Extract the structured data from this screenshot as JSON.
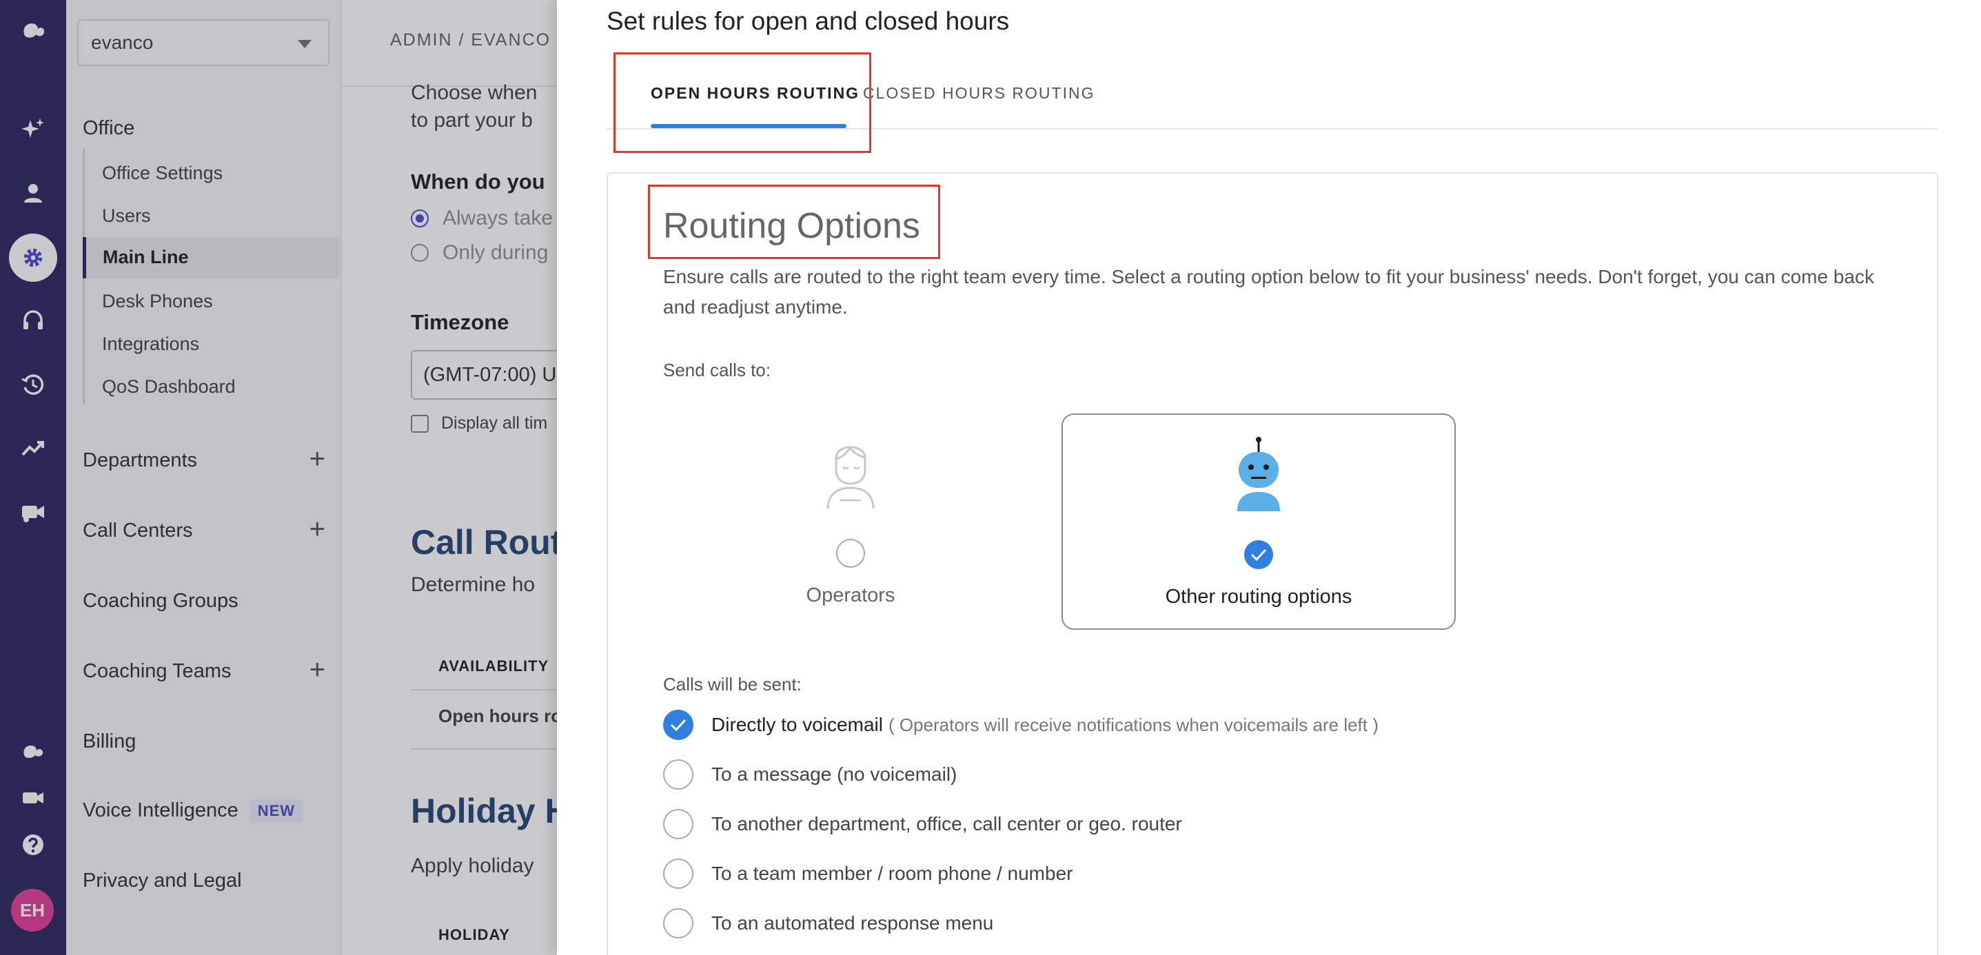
{
  "rail": {
    "icons": [
      "dialpad-logo-icon",
      "ai-sparkle-icon",
      "contacts-person-icon",
      "settings-gear-icon",
      "headset-icon",
      "history-icon",
      "analytics-trend-icon",
      "video-camera-icon",
      "dialpad-small-logo-icon",
      "meetings-video-icon",
      "help-icon"
    ],
    "avatar_initials": "EH",
    "avatar_color": "#e32f8c",
    "background_color": "#1b1656"
  },
  "nav": {
    "org_select_value": "evanco",
    "office_heading": "Office",
    "office_items": [
      "Office Settings",
      "Users",
      "Main Line",
      "Desk Phones",
      "Integrations",
      "QoS Dashboard"
    ],
    "active_item": "Main Line",
    "sections": [
      {
        "label": "Departments",
        "has_add": true
      },
      {
        "label": "Call Centers",
        "has_add": true
      },
      {
        "label": "Coaching Groups",
        "has_add": false
      },
      {
        "label": "Coaching Teams",
        "has_add": true
      },
      {
        "label": "Billing",
        "has_add": false
      },
      {
        "label": "Voice Intelligence",
        "has_add": false,
        "badge": "NEW"
      },
      {
        "label": "Privacy and Legal",
        "has_add": false
      }
    ]
  },
  "main": {
    "breadcrumb": "ADMIN / EVANCO",
    "intro_line1": "Choose when",
    "intro_line2": "to part your b",
    "when_heading": "When do you",
    "radio_always": "Always take",
    "radio_only": "Only during",
    "timezone_heading": "Timezone",
    "timezone_value": "(GMT-07:00) U",
    "display_all_label": "Display all tim",
    "call_routing_heading": "Call Rout",
    "call_routing_sub": "Determine ho",
    "availability_header": "AVAILABILITY",
    "open_hours_row": "Open hours ro",
    "holiday_heading": "Holiday H",
    "holiday_sub": "Apply holiday",
    "holiday_header": "HOLIDAY"
  },
  "drawer": {
    "title": "Set rules for open and closed hours",
    "tabs": [
      {
        "label": "OPEN HOURS ROUTING",
        "active": true
      },
      {
        "label": "CLOSED HOURS ROUTING",
        "active": false
      }
    ],
    "routing_heading": "Routing Options",
    "routing_description": "Ensure calls are routed to the right team every time. Select a routing option below to fit your business' needs. Don't forget, you can come back and readjust anytime.",
    "send_calls_label": "Send calls to:",
    "send_options": [
      {
        "label": "Operators",
        "selected": false,
        "icon": "operator-person-icon"
      },
      {
        "label": "Other routing options",
        "selected": true,
        "icon": "robot-icon"
      }
    ],
    "calls_sent_label": "Calls will be sent:",
    "route_options": [
      {
        "label": "Directly to voicemail",
        "note": "( Operators will receive notifications when voicemails are left )",
        "selected": true
      },
      {
        "label": "To a message (no voicemail)",
        "note": "",
        "selected": false
      },
      {
        "label": "To another department, office, call center or geo. router",
        "note": "",
        "selected": false
      },
      {
        "label": "To a team member / room phone / number",
        "note": "",
        "selected": false
      },
      {
        "label": "To an automated response menu",
        "note": "",
        "selected": false
      }
    ],
    "accent_color": "#2f7fe0",
    "highlight_color": "#e03a2a"
  }
}
